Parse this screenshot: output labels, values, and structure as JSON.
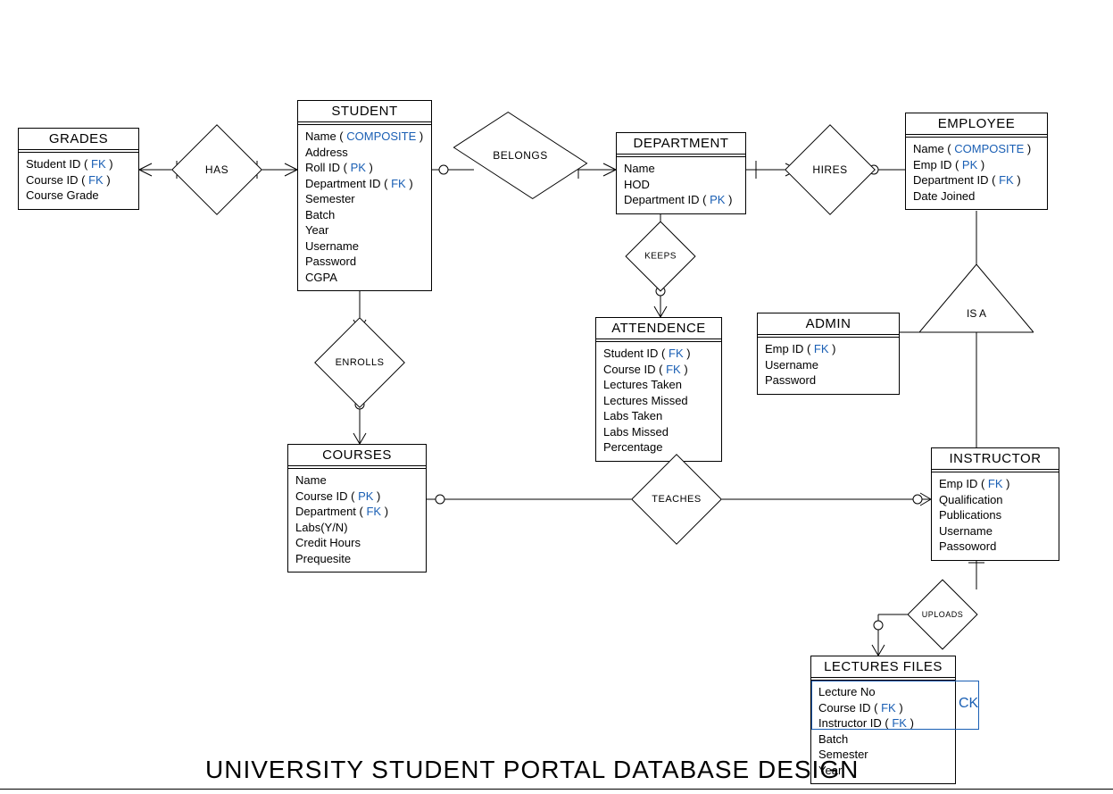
{
  "title": "UNIVERSITY STUDENT PORTAL DATABASE DESIGN",
  "keys": {
    "FK": "FK",
    "PK": "PK",
    "COMPOSITE": "COMPOSITE",
    "CK": "CK"
  },
  "entities": {
    "grades": {
      "title": "GRADES",
      "attrs": [
        "Student ID",
        "Course ID",
        "Course Grade"
      ],
      "attr_keys": [
        "FK",
        "FK",
        ""
      ]
    },
    "student": {
      "title": "STUDENT",
      "attrs": [
        "Name",
        "Address",
        "Roll ID",
        "Department ID",
        "Semester",
        "Batch",
        "Year",
        "Username",
        "Password",
        "CGPA"
      ],
      "attr_keys": [
        "COMPOSITE",
        "",
        "PK",
        "FK",
        "",
        "",
        "",
        "",
        "",
        ""
      ]
    },
    "department": {
      "title": "DEPARTMENT",
      "attrs": [
        "Name",
        "HOD",
        "Department ID"
      ],
      "attr_keys": [
        "",
        "",
        "PK"
      ]
    },
    "employee": {
      "title": "EMPLOYEE",
      "attrs": [
        "Name",
        "Emp ID",
        "Department ID",
        "Date Joined"
      ],
      "attr_keys": [
        "COMPOSITE",
        "PK",
        "FK",
        ""
      ]
    },
    "attendence": {
      "title": "ATTENDENCE",
      "attrs": [
        "Student ID",
        "Course ID",
        "Lectures Taken",
        "Lectures Missed",
        "Labs Taken",
        "Labs Missed",
        "Percentage"
      ],
      "attr_keys": [
        "FK",
        "FK",
        "",
        "",
        "",
        "",
        ""
      ]
    },
    "admin": {
      "title": "ADMIN",
      "attrs": [
        "Emp ID",
        "Username",
        "Password"
      ],
      "attr_keys": [
        "FK",
        "",
        ""
      ]
    },
    "courses": {
      "title": "COURSES",
      "attrs": [
        "Name",
        "Course ID",
        "Department",
        "Labs(Y/N)",
        "Credit Hours",
        "Prequesite"
      ],
      "attr_keys": [
        "",
        "PK",
        "FK",
        "",
        "",
        ""
      ]
    },
    "instructor": {
      "title": "INSTRUCTOR",
      "attrs": [
        "Emp ID",
        "Qualification",
        "Publications",
        "Username",
        "Passoword"
      ],
      "attr_keys": [
        "FK",
        "",
        "",
        "",
        ""
      ]
    },
    "lectures_files": {
      "title": "LECTURES FILES",
      "attrs": [
        "Lecture No",
        "Course ID",
        "Instructor ID",
        "Batch",
        "Semester",
        "Year"
      ],
      "attr_keys": [
        "",
        "FK",
        "FK",
        "",
        "",
        ""
      ]
    }
  },
  "relationships": {
    "has": "HAS",
    "belongs": "BELONGS",
    "hires": "HIRES",
    "keeps": "KEEPS",
    "enrolls": "ENROLLS",
    "teaches": "TEACHES",
    "uploads": "UPLOADS",
    "isa": "IS A"
  }
}
